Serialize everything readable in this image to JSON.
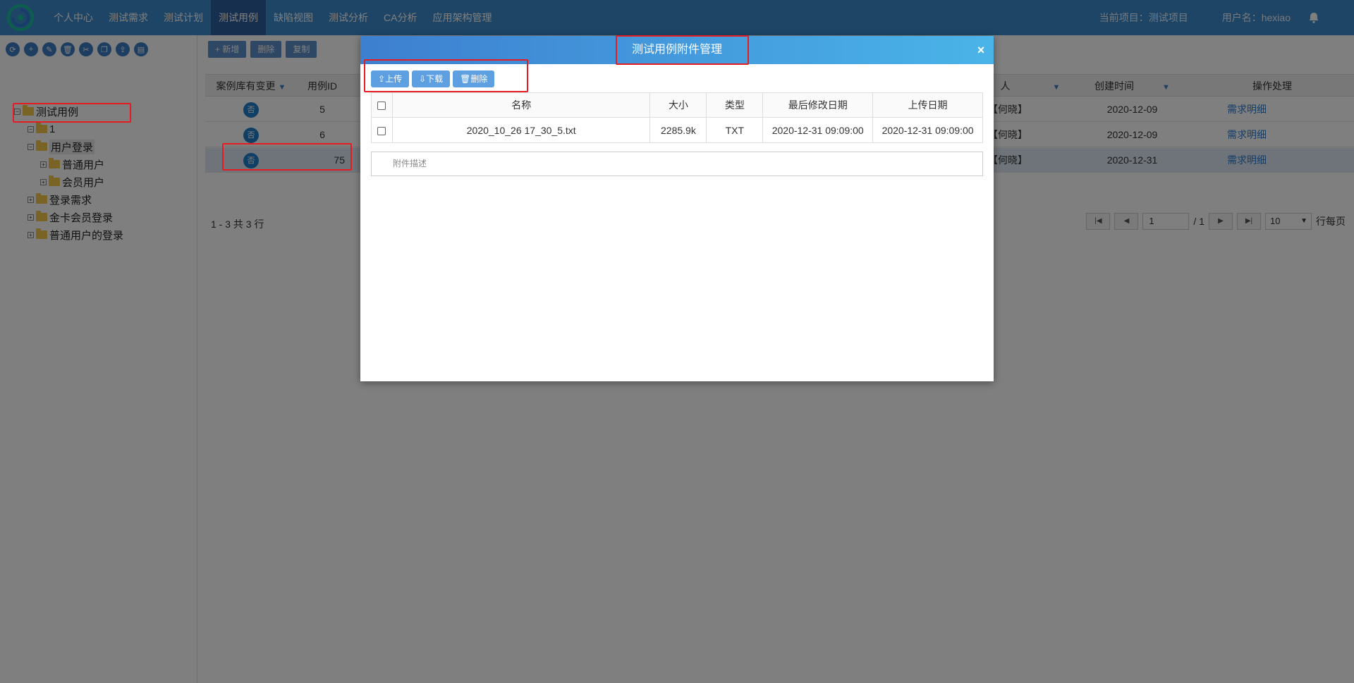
{
  "nav": {
    "items": [
      "个人中心",
      "测试需求",
      "测试计划",
      "测试用例",
      "缺陷视图",
      "测试分析",
      "CA分析",
      "应用架构管理"
    ],
    "active_index": 3,
    "project": "当前项目：测试项目",
    "user": "用户名：hexiao"
  },
  "tree": {
    "tools": [
      "refresh-icon",
      "add-icon",
      "edit-icon",
      "delete-icon",
      "cut-icon",
      "copy-icon",
      "import-icon",
      "export-icon"
    ],
    "nodes": [
      {
        "label": "测试用例"
      },
      {
        "label": "1"
      },
      {
        "label": "用户登录"
      },
      {
        "label": "普通用户"
      },
      {
        "label": "会员用户"
      },
      {
        "label": "登录需求"
      },
      {
        "label": "金卡会员登录"
      },
      {
        "label": "普通用户的登录"
      }
    ]
  },
  "toolbar": {
    "add": "+ 新增",
    "delete": "删除",
    "copy": "复制"
  },
  "grid": {
    "headers": {
      "changed": "案例库有变更",
      "id": "用例ID",
      "creator": "人",
      "created": "创建时间",
      "ops": "操作处理"
    },
    "rows": [
      {
        "changed": "否",
        "id": "5",
        "creator": "【何晓】",
        "created": "2020-12-09",
        "op": "需求明细"
      },
      {
        "changed": "否",
        "id": "6",
        "creator": "【何晓】",
        "created": "2020-12-09",
        "op": "需求明细"
      },
      {
        "changed": "否",
        "id": "75",
        "creator": "【何晓】",
        "created": "2020-12-31",
        "op": "需求明细"
      }
    ],
    "summary": "1 - 3 共 3 行",
    "page_input": "1",
    "page_total": "/ 1",
    "page_size": "10",
    "page_size_suffix": "行每页"
  },
  "dialog": {
    "title": "测试用例附件管理",
    "buttons": {
      "upload": "上传",
      "download": "下载",
      "delete": "删除"
    },
    "columns": {
      "name": "名称",
      "size": "大小",
      "type": "类型",
      "modified": "最后修改日期",
      "uploaded": "上传日期"
    },
    "files": [
      {
        "name": "2020_10_26 17_30_5.txt",
        "size": "2285.9k",
        "type": "TXT",
        "modified": "2020-12-31 09:09:00",
        "uploaded": "2020-12-31 09:09:00"
      }
    ],
    "description_placeholder": "附件描述"
  },
  "colors": {
    "topbar": "#3d8bcc",
    "accent": "#1f7fc8",
    "annotation": "#e51c23"
  }
}
